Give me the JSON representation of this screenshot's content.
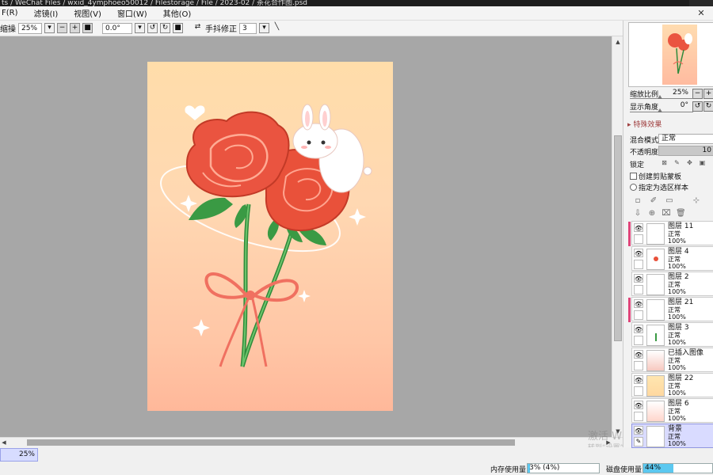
{
  "titlebar": {
    "path": "ts / WeChat Files / wxid_4ymphoeo50012 / Filestorage / File / 2023-02 / 茶花合作图.psd"
  },
  "menu": [
    {
      "label": "F(R)"
    },
    {
      "label": "滤镜(I)"
    },
    {
      "label": "视图(V)"
    },
    {
      "label": "窗口(W)"
    },
    {
      "label": "其他(O)"
    }
  ],
  "toolbar": {
    "zoom_label": "缩操",
    "zoom_value": "25%",
    "angle_value": "0.0°",
    "stabilizer_label": "手抖修正",
    "stabilizer_value": "3"
  },
  "navigator": {
    "zoom_label": "缩放比例",
    "zoom_value": "25%",
    "angle_label": "显示角度",
    "angle_value": "0°"
  },
  "layer_props": {
    "fx_header": "特殊效果",
    "blend_label": "混合模式",
    "blend_value": "正常",
    "opacity_label": "不透明度",
    "opacity_value": "10",
    "lock_label": "锁定",
    "clip_label": "创建剪贴蒙板",
    "selsource_label": "指定为选区样本"
  },
  "layers": [
    {
      "name": "图层 11",
      "mode": "正常",
      "opacity": "100%",
      "pink": true
    },
    {
      "name": "图层 4",
      "mode": "正常",
      "opacity": "100%",
      "pink": false
    },
    {
      "name": "图层 2",
      "mode": "正常",
      "opacity": "100%",
      "pink": false
    },
    {
      "name": "图层 21",
      "mode": "正常",
      "opacity": "100%",
      "pink": true
    },
    {
      "name": "图层 3",
      "mode": "正常",
      "opacity": "100%",
      "pink": false
    },
    {
      "name": "已插入图像",
      "mode": "正常",
      "opacity": "100%",
      "pink": false
    },
    {
      "name": "图层 22",
      "mode": "正常",
      "opacity": "100%",
      "pink": false
    },
    {
      "name": "图层 6",
      "mode": "正常",
      "opacity": "100%",
      "pink": false
    },
    {
      "name": "背景",
      "mode": "正常",
      "opacity": "100%",
      "pink": false
    }
  ],
  "status": {
    "zoom": "25%",
    "mem_label": "内存使用量",
    "mem_value": "3% (4%)",
    "mem_fraction": 0.03,
    "disk_label": "磁盘使用量",
    "disk_value": "44%",
    "disk_fraction": 0.44
  },
  "watermark": {
    "line1": "激活 Windows",
    "line2": "转到“设置”以激活 Windows"
  },
  "colors": {
    "accent_pink": "#e0457a",
    "progress_blue": "#5bc8f0",
    "selected_layer": "#d9dbff",
    "workspace_gray": "#a7a7a7"
  },
  "icons": [
    "close-icon",
    "minus-icon",
    "plus-icon",
    "reset-icon",
    "rotate-left-icon",
    "rotate-right-icon",
    "flip-icon",
    "line-icon",
    "lock-icon",
    "eye-icon",
    "new-layer-icon",
    "delete-icon"
  ]
}
